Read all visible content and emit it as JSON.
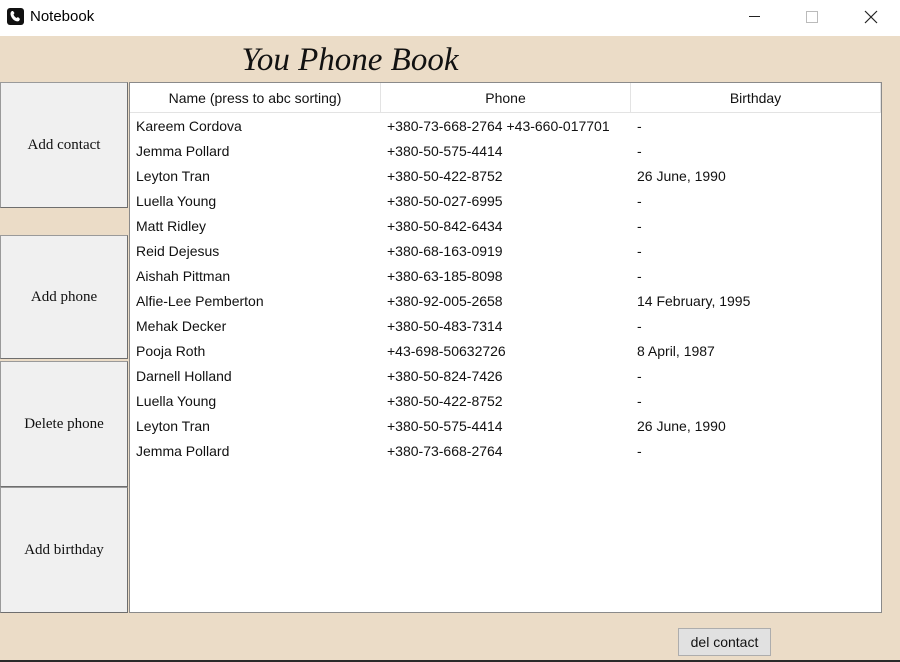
{
  "window": {
    "title": "Notebook",
    "icon": "phone-book-icon"
  },
  "heading": "You Phone Book",
  "side_buttons": {
    "add_contact": "Add contact",
    "add_phone": "Add phone",
    "delete_phone": "Delete phone",
    "add_birthday": "Add birthday"
  },
  "table": {
    "columns": [
      "Name (press to abc sorting)",
      "Phone",
      "Birthday"
    ],
    "rows": [
      [
        "Kareem Cordova",
        "+380-73-668-2764 +43-660-017701",
        "-"
      ],
      [
        "Jemma Pollard",
        "+380-50-575-4414",
        "-"
      ],
      [
        "Leyton Tran",
        "+380-50-422-8752",
        "26 June, 1990"
      ],
      [
        "Luella Young",
        "+380-50-027-6995",
        "-"
      ],
      [
        "Matt Ridley",
        "+380-50-842-6434",
        "-"
      ],
      [
        "Reid Dejesus",
        "+380-68-163-0919",
        "-"
      ],
      [
        "Aishah Pittman",
        "+380-63-185-8098",
        "-"
      ],
      [
        "Alfie-Lee Pemberton",
        "+380-92-005-2658",
        "14 February, 1995"
      ],
      [
        "Mehak Decker",
        "+380-50-483-7314",
        "-"
      ],
      [
        "Pooja Roth",
        "+43-698-50632726",
        "8 April, 1987"
      ],
      [
        "Darnell Holland",
        "+380-50-824-7426",
        "-"
      ],
      [
        "Luella Young",
        "+380-50-422-8752",
        "-"
      ],
      [
        "Leyton Tran",
        "+380-50-575-4414",
        "26 June, 1990"
      ],
      [
        "Jemma Pollard",
        "+380-73-668-2764",
        "-"
      ]
    ]
  },
  "footer": {
    "del_contact": "del contact"
  },
  "colors": {
    "background": "#ebdcc7",
    "button": "#f0f0f0",
    "table": "#ffffff"
  }
}
